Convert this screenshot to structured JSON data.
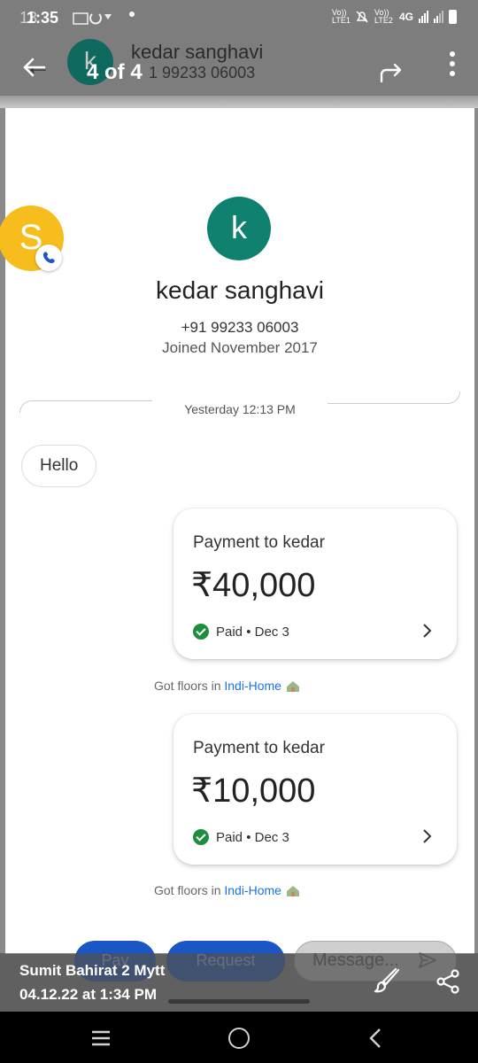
{
  "status_bar": {
    "time_ghost": "13",
    "time": "1:35",
    "network": "4G",
    "lte1": "Vo)) LTE1",
    "lte2": "Vo)) LTE2"
  },
  "header": {
    "avatar_letter": "k",
    "name": "kedar sanghavi",
    "phone_partial": "1 99233 06003"
  },
  "viewer": {
    "title": "4 of 4"
  },
  "contact": {
    "avatar_letter": "k",
    "name": "kedar sanghavi",
    "phone": "+91 99233 06003",
    "joined": "Joined November 2017"
  },
  "chat": {
    "divider": "Yesterday 12:13 PM",
    "messages": [
      {
        "text": "Hello"
      }
    ],
    "payments": [
      {
        "title": "Payment to kedar",
        "amount": "₹40,000",
        "status": "Paid • Dec 3",
        "note_prefix": "Got floors in ",
        "note_link": "Indi-Home"
      },
      {
        "title": "Payment to kedar",
        "amount": "₹10,000",
        "status": "Paid • Dec 3",
        "note_prefix": "Got floors in ",
        "note_link": "Indi-Home"
      }
    ]
  },
  "chathead": {
    "letter": "S"
  },
  "compose": {
    "pay_label": "Pay",
    "request_label": "Request",
    "message_placeholder": "Message..."
  },
  "caption": {
    "name": "Sumit Bahirat 2 Mytt",
    "date": "04.12.22 at 1:34 PM"
  },
  "colors": {
    "accent_blue": "#1a56c5",
    "avatar_green": "#10806f",
    "paid_green": "#1e8e3e",
    "chathead_yellow": "#f7bd1c",
    "link_blue": "#1a73e8"
  },
  "icons": [
    "back-arrow-icon",
    "forward-share-icon",
    "more-vert-icon",
    "check-circle-icon",
    "chevron-right-icon",
    "house-emoji-icon",
    "send-icon",
    "edit-brush-icon",
    "share-icon",
    "phone-call-icon",
    "nav-recents-icon",
    "nav-home-icon",
    "nav-back-icon"
  ]
}
